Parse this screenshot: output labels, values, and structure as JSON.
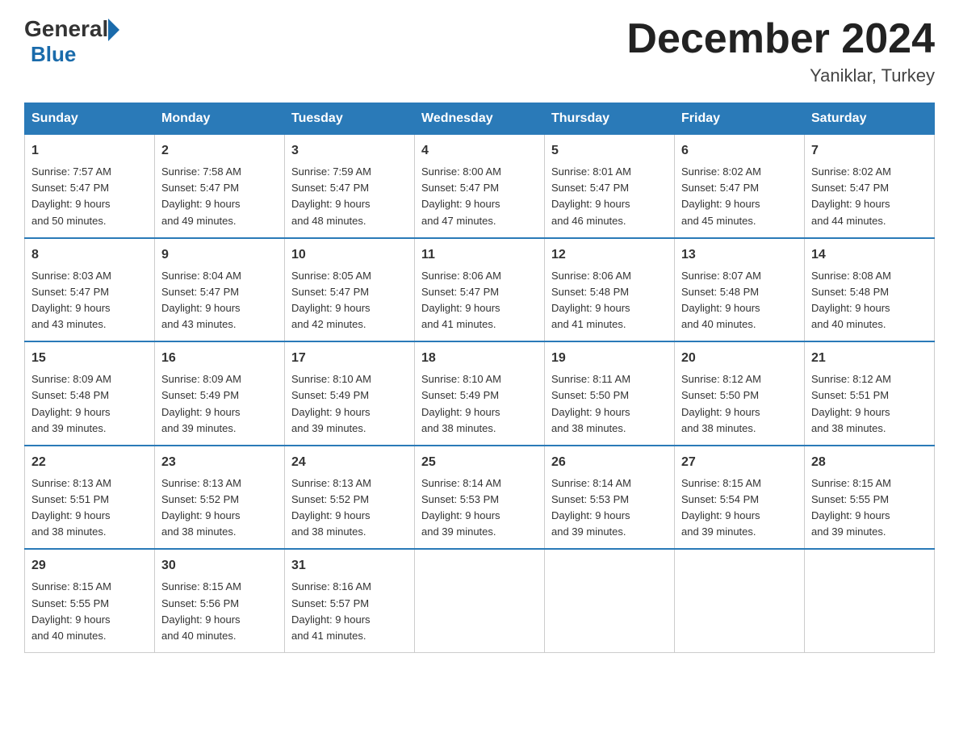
{
  "logo": {
    "general": "General",
    "blue": "Blue"
  },
  "title": "December 2024",
  "subtitle": "Yaniklar, Turkey",
  "days_header": [
    "Sunday",
    "Monday",
    "Tuesday",
    "Wednesday",
    "Thursday",
    "Friday",
    "Saturday"
  ],
  "weeks": [
    [
      {
        "num": "1",
        "sunrise": "7:57 AM",
        "sunset": "5:47 PM",
        "daylight": "9 hours and 50 minutes."
      },
      {
        "num": "2",
        "sunrise": "7:58 AM",
        "sunset": "5:47 PM",
        "daylight": "9 hours and 49 minutes."
      },
      {
        "num": "3",
        "sunrise": "7:59 AM",
        "sunset": "5:47 PM",
        "daylight": "9 hours and 48 minutes."
      },
      {
        "num": "4",
        "sunrise": "8:00 AM",
        "sunset": "5:47 PM",
        "daylight": "9 hours and 47 minutes."
      },
      {
        "num": "5",
        "sunrise": "8:01 AM",
        "sunset": "5:47 PM",
        "daylight": "9 hours and 46 minutes."
      },
      {
        "num": "6",
        "sunrise": "8:02 AM",
        "sunset": "5:47 PM",
        "daylight": "9 hours and 45 minutes."
      },
      {
        "num": "7",
        "sunrise": "8:02 AM",
        "sunset": "5:47 PM",
        "daylight": "9 hours and 44 minutes."
      }
    ],
    [
      {
        "num": "8",
        "sunrise": "8:03 AM",
        "sunset": "5:47 PM",
        "daylight": "9 hours and 43 minutes."
      },
      {
        "num": "9",
        "sunrise": "8:04 AM",
        "sunset": "5:47 PM",
        "daylight": "9 hours and 43 minutes."
      },
      {
        "num": "10",
        "sunrise": "8:05 AM",
        "sunset": "5:47 PM",
        "daylight": "9 hours and 42 minutes."
      },
      {
        "num": "11",
        "sunrise": "8:06 AM",
        "sunset": "5:47 PM",
        "daylight": "9 hours and 41 minutes."
      },
      {
        "num": "12",
        "sunrise": "8:06 AM",
        "sunset": "5:48 PM",
        "daylight": "9 hours and 41 minutes."
      },
      {
        "num": "13",
        "sunrise": "8:07 AM",
        "sunset": "5:48 PM",
        "daylight": "9 hours and 40 minutes."
      },
      {
        "num": "14",
        "sunrise": "8:08 AM",
        "sunset": "5:48 PM",
        "daylight": "9 hours and 40 minutes."
      }
    ],
    [
      {
        "num": "15",
        "sunrise": "8:09 AM",
        "sunset": "5:48 PM",
        "daylight": "9 hours and 39 minutes."
      },
      {
        "num": "16",
        "sunrise": "8:09 AM",
        "sunset": "5:49 PM",
        "daylight": "9 hours and 39 minutes."
      },
      {
        "num": "17",
        "sunrise": "8:10 AM",
        "sunset": "5:49 PM",
        "daylight": "9 hours and 39 minutes."
      },
      {
        "num": "18",
        "sunrise": "8:10 AM",
        "sunset": "5:49 PM",
        "daylight": "9 hours and 38 minutes."
      },
      {
        "num": "19",
        "sunrise": "8:11 AM",
        "sunset": "5:50 PM",
        "daylight": "9 hours and 38 minutes."
      },
      {
        "num": "20",
        "sunrise": "8:12 AM",
        "sunset": "5:50 PM",
        "daylight": "9 hours and 38 minutes."
      },
      {
        "num": "21",
        "sunrise": "8:12 AM",
        "sunset": "5:51 PM",
        "daylight": "9 hours and 38 minutes."
      }
    ],
    [
      {
        "num": "22",
        "sunrise": "8:13 AM",
        "sunset": "5:51 PM",
        "daylight": "9 hours and 38 minutes."
      },
      {
        "num": "23",
        "sunrise": "8:13 AM",
        "sunset": "5:52 PM",
        "daylight": "9 hours and 38 minutes."
      },
      {
        "num": "24",
        "sunrise": "8:13 AM",
        "sunset": "5:52 PM",
        "daylight": "9 hours and 38 minutes."
      },
      {
        "num": "25",
        "sunrise": "8:14 AM",
        "sunset": "5:53 PM",
        "daylight": "9 hours and 39 minutes."
      },
      {
        "num": "26",
        "sunrise": "8:14 AM",
        "sunset": "5:53 PM",
        "daylight": "9 hours and 39 minutes."
      },
      {
        "num": "27",
        "sunrise": "8:15 AM",
        "sunset": "5:54 PM",
        "daylight": "9 hours and 39 minutes."
      },
      {
        "num": "28",
        "sunrise": "8:15 AM",
        "sunset": "5:55 PM",
        "daylight": "9 hours and 39 minutes."
      }
    ],
    [
      {
        "num": "29",
        "sunrise": "8:15 AM",
        "sunset": "5:55 PM",
        "daylight": "9 hours and 40 minutes."
      },
      {
        "num": "30",
        "sunrise": "8:15 AM",
        "sunset": "5:56 PM",
        "daylight": "9 hours and 40 minutes."
      },
      {
        "num": "31",
        "sunrise": "8:16 AM",
        "sunset": "5:57 PM",
        "daylight": "9 hours and 41 minutes."
      },
      null,
      null,
      null,
      null
    ]
  ],
  "labels": {
    "sunrise_prefix": "Sunrise: ",
    "sunset_prefix": "Sunset: ",
    "daylight_prefix": "Daylight: "
  }
}
